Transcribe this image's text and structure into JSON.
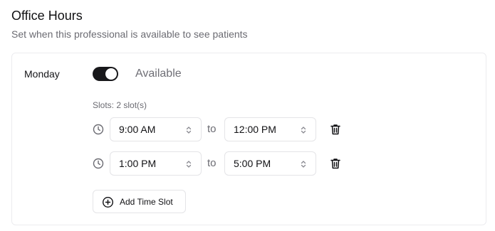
{
  "header": {
    "title": "Office Hours",
    "subtitle": "Set when this professional is available to see patients"
  },
  "day": {
    "name": "Monday",
    "enabled": true,
    "status_label": "Available",
    "slots_label": "Slots: 2 slot(s)",
    "slots": [
      {
        "start": "9:00 AM",
        "separator": "to",
        "end": "12:00 PM"
      },
      {
        "start": "1:00 PM",
        "separator": "to",
        "end": "5:00 PM"
      }
    ],
    "add_button_label": "Add Time Slot"
  },
  "icons": {
    "slot_icon": "clock-icon",
    "select_icon": "chevron-up-down-icon",
    "delete_icon": "trash-icon",
    "add_icon": "plus-circle-icon"
  },
  "colors": {
    "toggle_on": "#18181b",
    "muted_text": "#6b6b72",
    "border": "#e4e4e7"
  }
}
